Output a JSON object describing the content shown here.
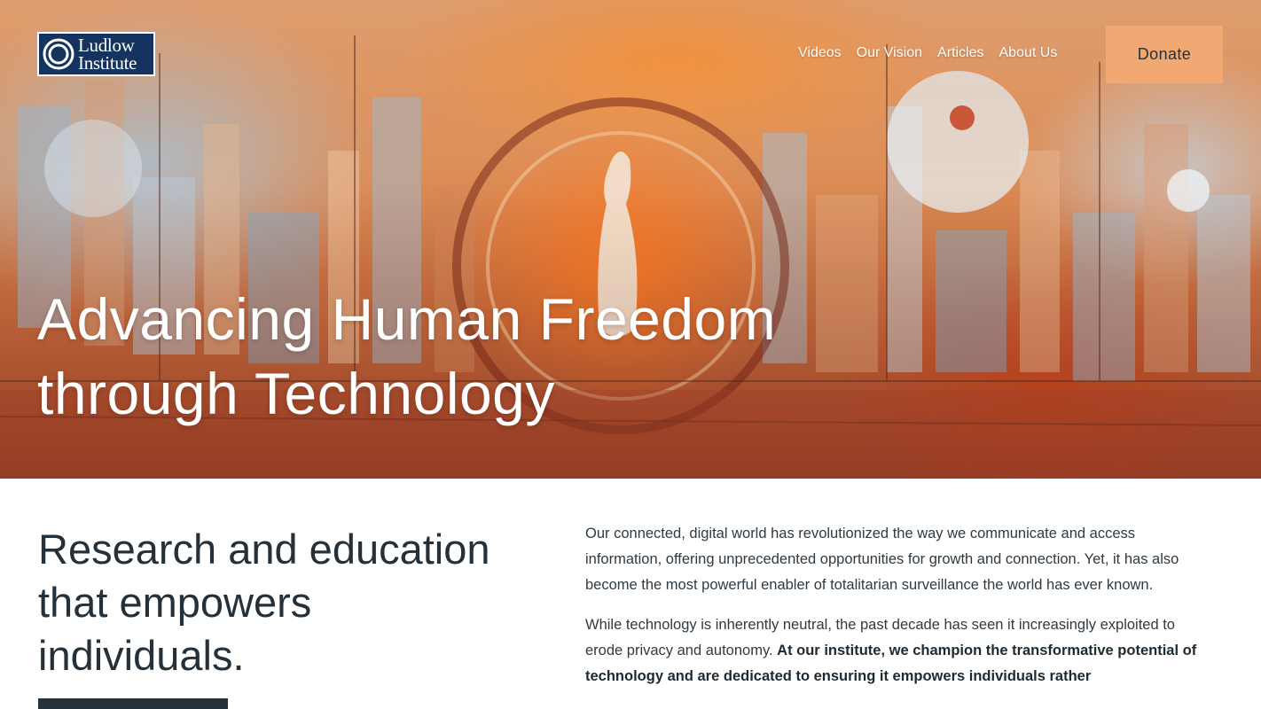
{
  "logo": {
    "line1": "Ludlow",
    "line2": "Institute"
  },
  "nav": {
    "items": [
      "Videos",
      "Our Vision",
      "Articles",
      "About Us"
    ],
    "donate_label": "Donate"
  },
  "hero": {
    "title_line1": "Advancing Human Freedom",
    "title_line2": "through Technology"
  },
  "section": {
    "heading_line1": "Research and education",
    "heading_line2": "that empowers",
    "heading_line3": "individuals."
  },
  "body": {
    "paragraph1": "Our connected, digital world has revolutionized the way we communicate and access information, offering unprecedented opportunities for growth and connection. Yet, it has also become the most powerful enabler of totalitarian surveillance the world has ever known.",
    "paragraph2_plain": "While technology is inherently neutral, the past decade has seen it increasingly exploited to erode privacy and autonomy. ",
    "paragraph2_bold": "At our institute, we champion the transformative potential of technology and are dedicated to ensuring it empowers individuals rather"
  },
  "colors": {
    "accent": "#f1a873",
    "dark": "#24313a",
    "logo_bg": "#14345f"
  }
}
